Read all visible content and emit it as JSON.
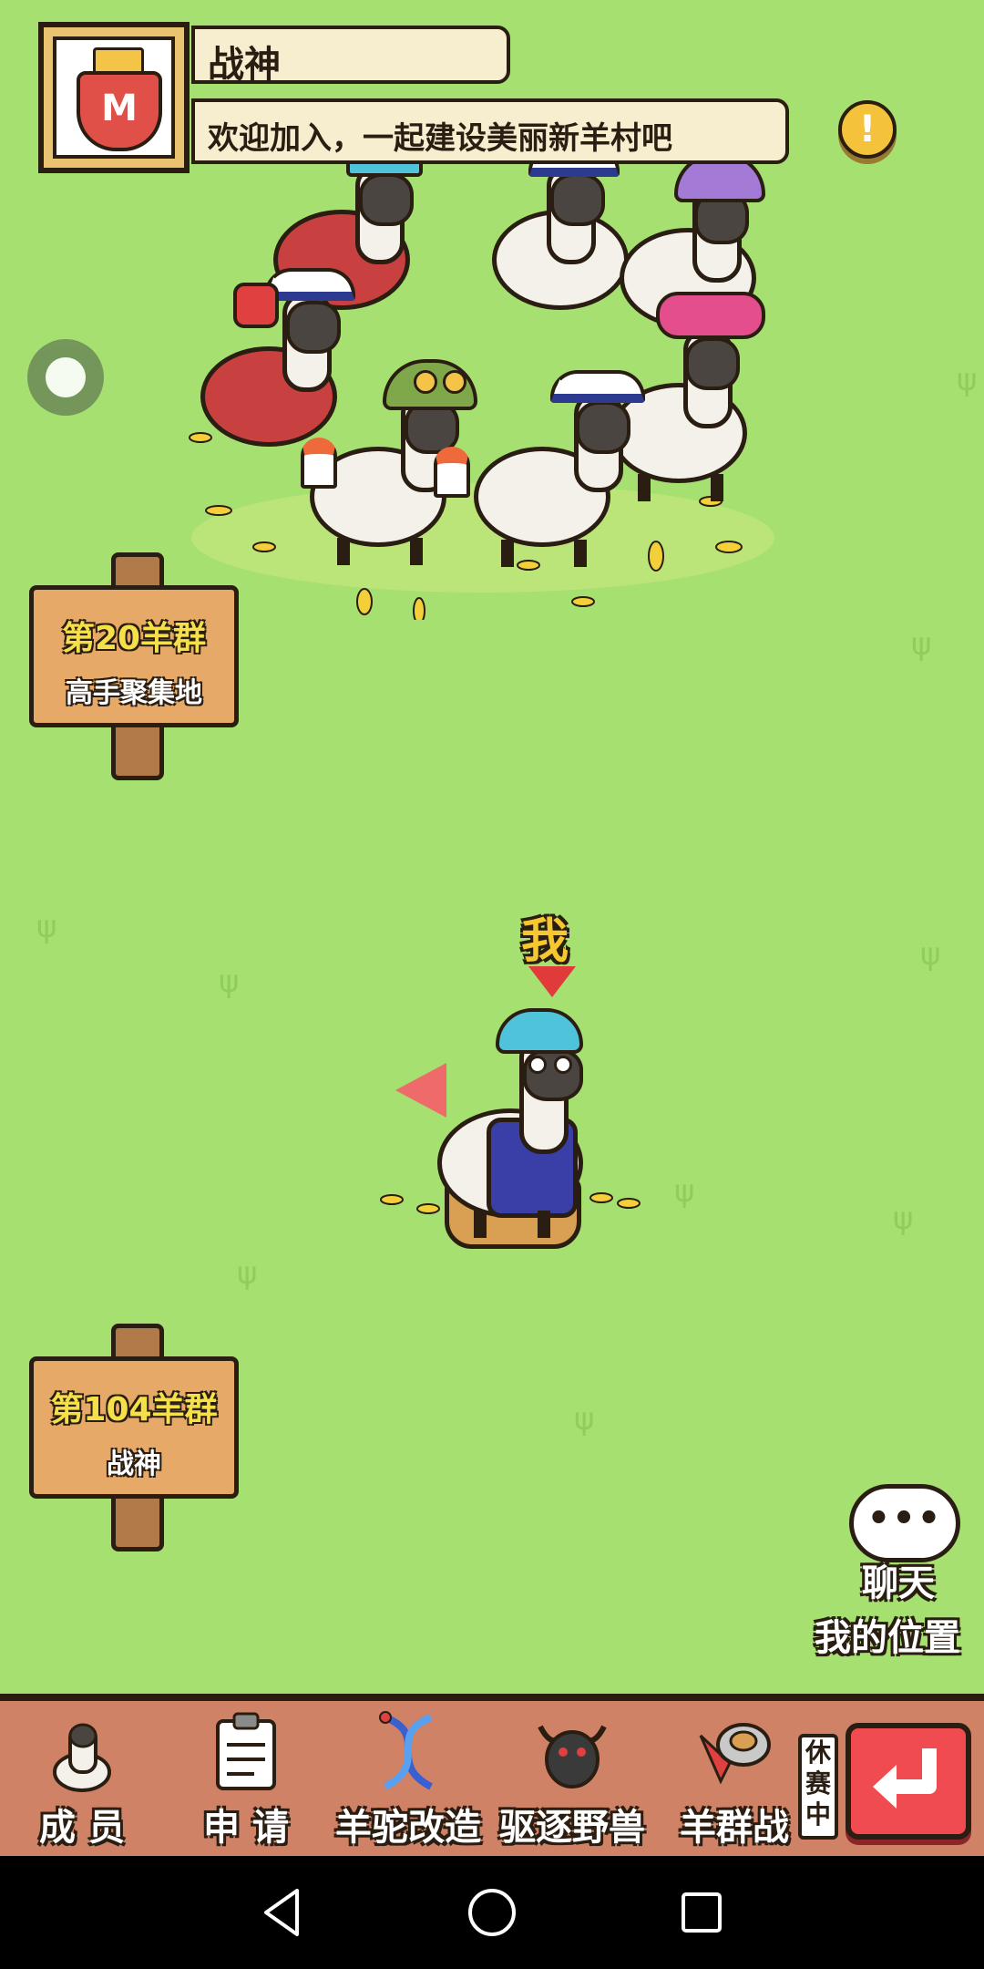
{
  "header": {
    "group_name": "战神",
    "announcement": "欢迎加入，一起建设美丽新羊村吧",
    "alert_symbol": "!"
  },
  "signs": [
    {
      "line1": "第20羊群",
      "line2": "高手聚集地"
    },
    {
      "line1": "第104羊群",
      "line2": "战神"
    }
  ],
  "player": {
    "label": "我"
  },
  "chat": {
    "bubble": "•••",
    "label": "聊天",
    "my_position": "我的位置"
  },
  "toolbar": {
    "members": "成 员",
    "apply": "申 请",
    "modify": "羊驼改造",
    "expel": "驱逐野兽",
    "battle": "羊群战",
    "battle_status": "休赛中"
  },
  "colors": {
    "grass": "#a6e070",
    "toolbar": "#cf8266",
    "back_button": "#ef4b50",
    "sign_board": "#e7a968"
  },
  "icons": {
    "nav_back": "triangle-back-icon",
    "nav_home": "circle-home-icon",
    "nav_recents": "square-recents-icon"
  }
}
